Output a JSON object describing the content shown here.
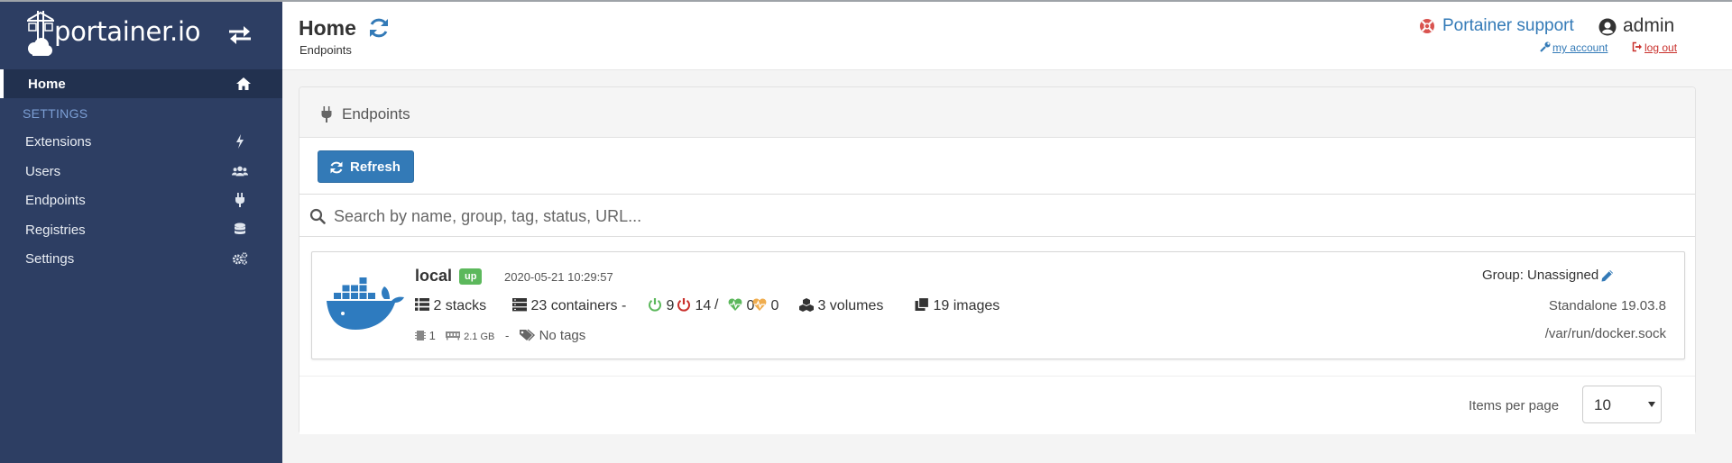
{
  "app": {
    "brand_name": "portainer.io",
    "accent_color": "#337ab7",
    "sidebar_color": "#2d3e63"
  },
  "sidebar": {
    "home_label": "Home",
    "section_label": "SETTINGS",
    "items": [
      {
        "label": "Extensions",
        "icon": "bolt-icon"
      },
      {
        "label": "Users",
        "icon": "users-icon"
      },
      {
        "label": "Endpoints",
        "icon": "plug-icon"
      },
      {
        "label": "Registries",
        "icon": "database-icon"
      },
      {
        "label": "Settings",
        "icon": "cogs-icon"
      }
    ]
  },
  "header": {
    "title": "Home",
    "breadcrumb": "Endpoints",
    "support_label": "Portainer support",
    "username": "admin",
    "account_link": "my account",
    "logout_link": "log out"
  },
  "widget": {
    "title": "Endpoints",
    "refresh_label": "Refresh",
    "search_placeholder": "Search by name, group, tag, status, URL..."
  },
  "endpoint": {
    "name": "local",
    "status": "up",
    "status_color": "#5cb85c",
    "timestamp": "2020-05-21 10:29:57",
    "stacks": "2 stacks",
    "containers": "23 containers -",
    "running": "9",
    "stopped": "14",
    "separator": "/",
    "healthy": "0",
    "unhealthy": "0",
    "volumes": "3 volumes",
    "images": "19 images",
    "cpu": "1",
    "memory": "2.1 GB",
    "meta_sep": "-",
    "tags": "No tags",
    "group": "Group: Unassigned",
    "version": "Standalone 19.03.8",
    "url": "/var/run/docker.sock"
  },
  "pagination": {
    "label": "Items per page",
    "value": "10"
  }
}
